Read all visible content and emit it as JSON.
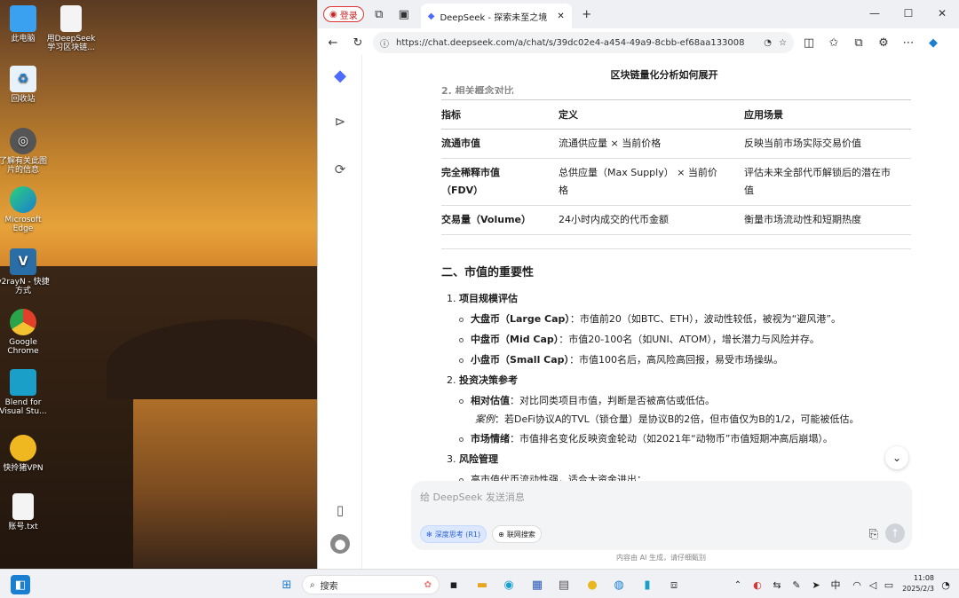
{
  "desktop": {
    "icons": [
      {
        "label": "此电脑",
        "icon": "computer-icon",
        "color": "#3aa0f0"
      },
      {
        "label": "用DeepSeek学习区块链...",
        "icon": "document-icon",
        "color": "#f4f4f4"
      },
      {
        "label": "回收站",
        "icon": "recycle-bin-icon",
        "color": "#e8f2fa"
      },
      {
        "label": "了解有关此图片的信息",
        "icon": "camera-icon",
        "color": "#555555"
      },
      {
        "label": "Microsoft Edge",
        "icon": "edge-icon",
        "color": "#1da1d8"
      },
      {
        "label": "v2rayN - 快捷方式",
        "icon": "v2ray-icon",
        "color": "#2a6ea8"
      },
      {
        "label": "Google Chrome",
        "icon": "chrome-icon",
        "color": "#e0402a"
      },
      {
        "label": "Blend for Visual Stu...",
        "icon": "blend-icon",
        "color": "#1aa0c8"
      },
      {
        "label": "快拎猪VPN",
        "icon": "vpn-icon",
        "color": "#f0b820"
      },
      {
        "label": "账号.txt",
        "icon": "text-file-icon",
        "color": "#f4f4f4"
      }
    ]
  },
  "browser": {
    "login_label": "登录",
    "tab_title": "DeepSeek - 探索未至之境",
    "url": "https://chat.deepseek.com/a/chat/s/39dc02e4-a454-49a9-8cbb-ef68aa133008"
  },
  "chat": {
    "title": "区块链量化分析如何展开",
    "cut_heading": "2. 相关概念对比",
    "table": {
      "headers": [
        "指标",
        "定义",
        "应用场景"
      ],
      "rows": [
        [
          "流通市值",
          "流通供应量 × 当前价格",
          "反映当前市场实际交易价值"
        ],
        [
          "完全稀释市值（FDV）",
          "总供应量（Max Supply） × 当前价格",
          "评估未来全部代币解锁后的潜在市值"
        ],
        [
          "交易量（Volume）",
          "24小时内成交的代币金额",
          "衡量市场流动性和短期热度"
        ]
      ]
    },
    "section_title": "二、市值的重要性",
    "item1_num": "1.",
    "item1_title": "项目规模评估",
    "item1_sub": [
      {
        "bold": "大盘币（Large Cap）",
        "text": "：市值前20（如BTC、ETH），波动性较低，被视为“避风港”。"
      },
      {
        "bold": "中盘币（Mid Cap）",
        "text": "：市值20-100名（如UNI、ATOM），增长潜力与风险并存。"
      },
      {
        "bold": "小盘币（Small Cap）",
        "text": "：市值100名后，高风险高回报，易受市场操纵。"
      }
    ],
    "item2_num": "2.",
    "item2_title": "投资决策参考",
    "item2_sub1_bold": "相对估值",
    "item2_sub1_text": "：对比同类项目市值，判断是否被高估或低估。",
    "item2_example_label": "案例",
    "item2_example_text": "：若DeFi协议A的TVL（锁仓量）是协议B的2倍，但市值仅为B的1/2，可能被低估。",
    "item2_sub2_bold": "市场情绪",
    "item2_sub2_text": "：市值排名变化反映资金轮动（如2021年“动物币”市值短期冲高后崩塌）。",
    "item3_num": "3.",
    "item3_title": "风险管理",
    "item3_sub1": "高市值代币流动性强，适合大资金进出；",
    "input_placeholder": "给 DeepSeek 发送消息",
    "chip_deep": "深度思考 (R1)",
    "chip_search": "联网搜索",
    "disclaimer": "内容由 AI 生成，请仔细甄别"
  },
  "taskbar": {
    "search_label": "搜索",
    "ime": "中",
    "time": "11:08",
    "date": "2025/2/3"
  }
}
